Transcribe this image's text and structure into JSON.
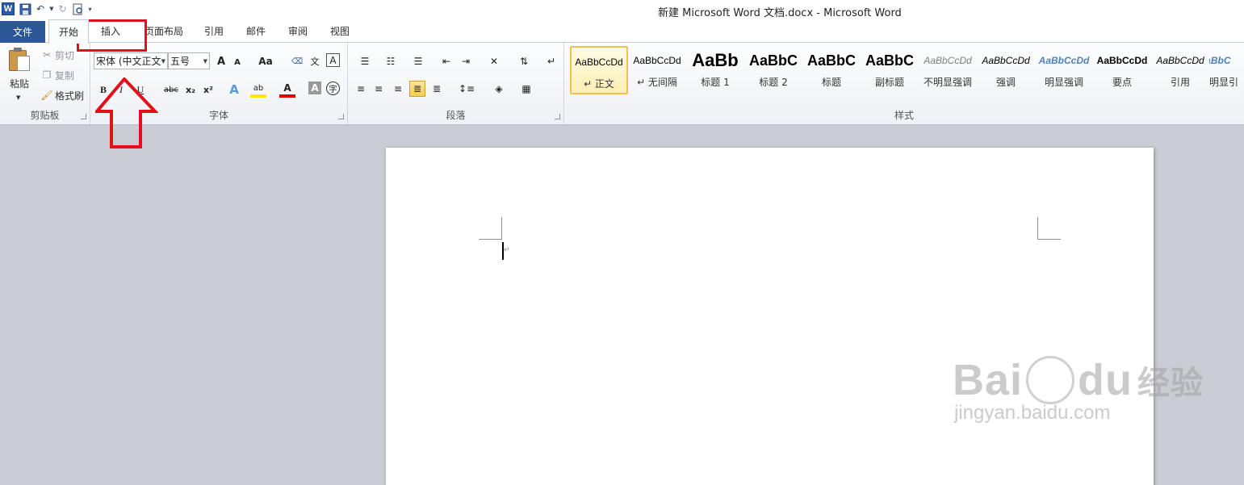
{
  "window": {
    "title": "新建 Microsoft Word 文档.docx - Microsoft Word",
    "app_logo": "W"
  },
  "tabs": [
    {
      "label": "文件"
    },
    {
      "label": "开始"
    },
    {
      "label": "插入"
    },
    {
      "label": "页面布局"
    },
    {
      "label": "引用"
    },
    {
      "label": "邮件"
    },
    {
      "label": "审阅"
    },
    {
      "label": "视图"
    }
  ],
  "clipboard": {
    "group_label": "剪贴板",
    "paste": "粘贴",
    "cut": "剪切",
    "copy": "复制",
    "format_painter": "格式刷"
  },
  "font": {
    "group_label": "字体",
    "font_name": "宋体 (中文正文",
    "font_size": "五号",
    "grow": "A",
    "shrink": "A",
    "change_case": "Aa",
    "bold": "B",
    "italic": "I",
    "underline": "U",
    "strikethrough": "abc",
    "subscript": "x₂",
    "superscript": "x²",
    "highlight": "ab",
    "font_color": "A",
    "char_shading": "A",
    "enclose": "字",
    "pinyin": "文",
    "wen": "wén",
    "border": "A"
  },
  "paragraph": {
    "group_label": "段落"
  },
  "styles": {
    "group_label": "样式",
    "items": [
      {
        "sample": "AaBbCcDd",
        "name": "↵ 正文"
      },
      {
        "sample": "AaBbCcDd",
        "name": "↵ 无间隔"
      },
      {
        "sample": "AaBb",
        "name": "标题 1"
      },
      {
        "sample": "AaBbC",
        "name": "标题 2"
      },
      {
        "sample": "AaBbC",
        "name": "标题"
      },
      {
        "sample": "AaBbC",
        "name": "副标题"
      },
      {
        "sample": "AaBbCcDd",
        "name": "不明显强调"
      },
      {
        "sample": "AaBbCcDd",
        "name": "强调"
      },
      {
        "sample": "AaBbCcDd",
        "name": "明显强调"
      },
      {
        "sample": "AaBbCcDd",
        "name": "要点"
      },
      {
        "sample": "AaBbCcDd",
        "name": "引用"
      },
      {
        "sample": "AaBbC",
        "name": "明显引"
      }
    ]
  },
  "watermark": {
    "logo_text_a": "Bai",
    "logo_text_b": "du",
    "logo_cn": "经验",
    "url": "jingyan.baidu.com"
  },
  "colors": {
    "file_tab": "#2b5797",
    "annotation_red": "#e3101b",
    "selected_style": "#f5c04a"
  }
}
